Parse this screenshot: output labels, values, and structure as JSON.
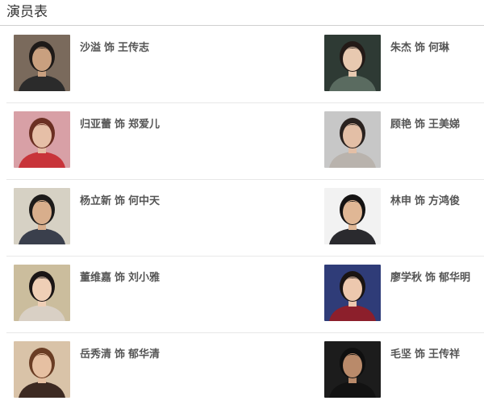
{
  "section_title": "演员表",
  "role_separator": "饰",
  "cast": [
    {
      "actor": "沙溢",
      "role": "王传志",
      "photo_bg": "#7a6a5c",
      "skin": "#c9a07f",
      "hair": "#1e1a18",
      "shirt": "#2b2b2b"
    },
    {
      "actor": "朱杰",
      "role": "何琳",
      "photo_bg": "#2e3a34",
      "skin": "#e8c9b0",
      "hair": "#231a17",
      "shirt": "#5a6b60"
    },
    {
      "actor": "归亚蕾",
      "role": "郑爱儿",
      "photo_bg": "#d8a0a6",
      "skin": "#e6bfa7",
      "hair": "#6b2f22",
      "shirt": "#c8343a"
    },
    {
      "actor": "顾艳",
      "role": "王美娣",
      "photo_bg": "#c7c7c7",
      "skin": "#e3bfa6",
      "hair": "#2a221f",
      "shirt": "#b9b3ad"
    },
    {
      "actor": "杨立新",
      "role": "何中天",
      "photo_bg": "#d6d1c4",
      "skin": "#d8ae8c",
      "hair": "#1d1b1a",
      "shirt": "#3a3f4c"
    },
    {
      "actor": "林申",
      "role": "方鸿俊",
      "photo_bg": "#f2f2f2",
      "skin": "#e0b795",
      "hair": "#151313",
      "shirt": "#2a2a2e"
    },
    {
      "actor": "董维嘉",
      "role": "刘小雅",
      "photo_bg": "#cbbd9d",
      "skin": "#efcfb6",
      "hair": "#1a1515",
      "shirt": "#d9d0c5"
    },
    {
      "actor": "廖学秋",
      "role": "郁华明",
      "photo_bg": "#2f3c78",
      "skin": "#edc8ae",
      "hair": "#1a1412",
      "shirt": "#8c1f2b"
    },
    {
      "actor": "岳秀清",
      "role": "郁华清",
      "photo_bg": "#d9c3a8",
      "skin": "#e6c0a2",
      "hair": "#6a3d24",
      "shirt": "#3d2a22"
    },
    {
      "actor": "毛坚",
      "role": "王传祥",
      "photo_bg": "#1c1c1c",
      "skin": "#b98a6a",
      "hair": "#0f0f0f",
      "shirt": "#121212"
    }
  ]
}
